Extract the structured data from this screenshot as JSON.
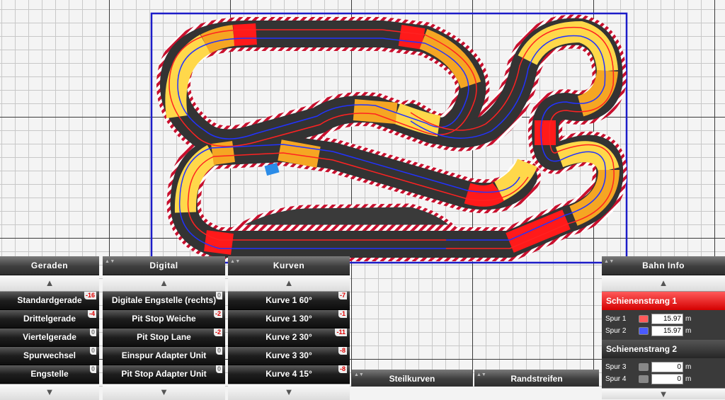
{
  "colors": {
    "grid_major": "#3a3a3a",
    "grid_minor": "#c8c8c8",
    "frame": "#1c1cc8",
    "track_dark": "#333333",
    "curve_yellow": "#ffd84a",
    "curve_orange": "#f5a623",
    "curve_red": "#ff1a1a",
    "border_stripe": "#c8102e",
    "lane_red": "#ff2222",
    "lane_blue": "#2233ff",
    "info_active": "#e60000"
  },
  "panels": {
    "geraden": {
      "title": "Geraden",
      "items": [
        {
          "label": "Standardgerade",
          "count": "-16"
        },
        {
          "label": "Drittelgerade",
          "count": "-4"
        },
        {
          "label": "Viertelgerade",
          "count": "0"
        },
        {
          "label": "Spurwechsel",
          "count": "0"
        },
        {
          "label": "Engstelle",
          "count": "0"
        }
      ]
    },
    "digital": {
      "title": "Digital",
      "items": [
        {
          "label": "Digitale Engstelle (rechts)",
          "count": "0"
        },
        {
          "label": "Pit Stop Weiche",
          "count": "-2"
        },
        {
          "label": "Pit Stop Lane",
          "count": "-2"
        },
        {
          "label": "Einspur Adapter Unit",
          "count": "0"
        },
        {
          "label": "Pit Stop Adapter Unit",
          "count": "0"
        }
      ]
    },
    "kurven": {
      "title": "Kurven",
      "items": [
        {
          "label": "Kurve 1 60°",
          "count": "-7"
        },
        {
          "label": "Kurve 1 30°",
          "count": "-1"
        },
        {
          "label": "Kurve 2 30°",
          "count": "-11"
        },
        {
          "label": "Kurve 3 30°",
          "count": "-8"
        },
        {
          "label": "Kurve 4 15°",
          "count": "-8"
        }
      ]
    }
  },
  "tabs": {
    "steilkurven": "Steilkurven",
    "randstreifen": "Randstreifen"
  },
  "info": {
    "title": "Bahn Info",
    "strang1": {
      "title": "Schienenstrang 1",
      "lanes": [
        {
          "label": "Spur 1",
          "value": "15.97",
          "unit": "m",
          "color": "#ff5a5a"
        },
        {
          "label": "Spur 2",
          "value": "15.97",
          "unit": "m",
          "color": "#4a5aff"
        }
      ]
    },
    "strang2": {
      "title": "Schienenstrang 2",
      "lanes": [
        {
          "label": "Spur 3",
          "value": "0",
          "unit": "m",
          "color": "#888888"
        },
        {
          "label": "Spur 4",
          "value": "0",
          "unit": "m",
          "color": "#888888"
        }
      ]
    }
  },
  "icons": {
    "up": "▲",
    "down": "▼",
    "spin": "▲▼"
  }
}
